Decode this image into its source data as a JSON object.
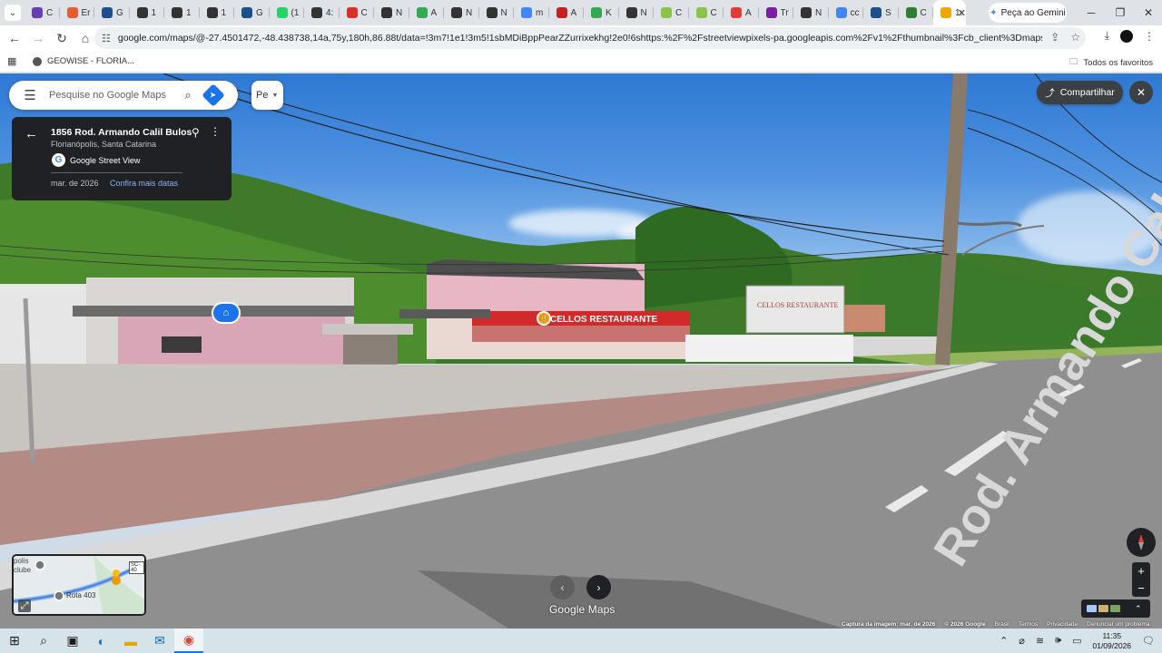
{
  "browser": {
    "tabs": [
      {
        "label": "C",
        "color": "#6a3fb5"
      },
      {
        "label": "Er",
        "color": "#e25d33"
      },
      {
        "label": "G",
        "color": "#1d4f8c"
      },
      {
        "label": "1",
        "color": "#333333"
      },
      {
        "label": "1",
        "color": "#333333"
      },
      {
        "label": "1",
        "color": "#333333"
      },
      {
        "label": "G",
        "color": "#1d4f8c"
      },
      {
        "label": "(1",
        "color": "#25d366"
      },
      {
        "label": "4:",
        "color": "#333333"
      },
      {
        "label": "C",
        "color": "#d93025"
      },
      {
        "label": "N",
        "color": "#333333"
      },
      {
        "label": "A",
        "color": "#34a853"
      },
      {
        "label": "N",
        "color": "#333333"
      },
      {
        "label": "N",
        "color": "#333333"
      },
      {
        "label": "m",
        "color": "#4285f4"
      },
      {
        "label": "A",
        "color": "#c5221f"
      },
      {
        "label": "K",
        "color": "#34a853"
      },
      {
        "label": "N",
        "color": "#333333"
      },
      {
        "label": "C",
        "color": "#8bc34a"
      },
      {
        "label": "C",
        "color": "#8bc34a"
      },
      {
        "label": "A",
        "color": "#e53935"
      },
      {
        "label": "Tr",
        "color": "#7b1fa2"
      },
      {
        "label": "N",
        "color": "#333333"
      },
      {
        "label": "cc",
        "color": "#4285f4"
      },
      {
        "label": "S",
        "color": "#1d4f8c"
      },
      {
        "label": "C",
        "color": "#2e7d32"
      },
      {
        "label": "1:",
        "color": "#f2a600"
      }
    ],
    "active_tab_close": "✕",
    "new_tab": "+",
    "gemini_label": "Peça ao Gemini",
    "url": "google.com/maps/@-27.4501472,-48.438738,14a,75y,180h,86.88t/data=!3m7!1e1!3m5!1sbMDiBppPearZZurrixekhg!2e0!6shttps:%2F%2Fstreetviewpixels-pa.googleapis.com%2Fv1%2Fthumbnail%3Fcb_client%3Dmaps_sv.tactile%26w%3D900%26h...",
    "bookmarks": [
      {
        "label": "GEOWISE - FLORIA..."
      }
    ],
    "all_bookmarks": "Todos os favoritos"
  },
  "maps": {
    "search_placeholder": "Pesquise no Google Maps",
    "layer_chip_label": "Pe",
    "card": {
      "title": "1856 Rod. Armando Calil Bulos",
      "subtitle": "Florianópolis, Santa Catarina",
      "provider": "Google Street View",
      "date": "mar. de 2026",
      "more_dates": "Confira mais datas"
    },
    "share_label": "Compartilhar",
    "minimap": {
      "label_top": "polis",
      "label_top2": "clube",
      "road": "Rota 403",
      "badge": "SC-40"
    },
    "logo": "Google Maps",
    "zoom_in": "+",
    "zoom_out": "−",
    "footer": [
      "Captura da imagem: mar. de 2026",
      "© 2026 Google",
      "Brasil",
      "Termos",
      "Privacidade",
      "Denunciar um problema"
    ]
  },
  "scene_text": {
    "restaurant_sign": "CELLOS RESTAURANTE",
    "road_marking": "Rod. Armando Cal",
    "billboard": "CELLOS RESTAURANTE"
  },
  "taskbar": {
    "time": "11:35",
    "date": "01/09/2026"
  }
}
